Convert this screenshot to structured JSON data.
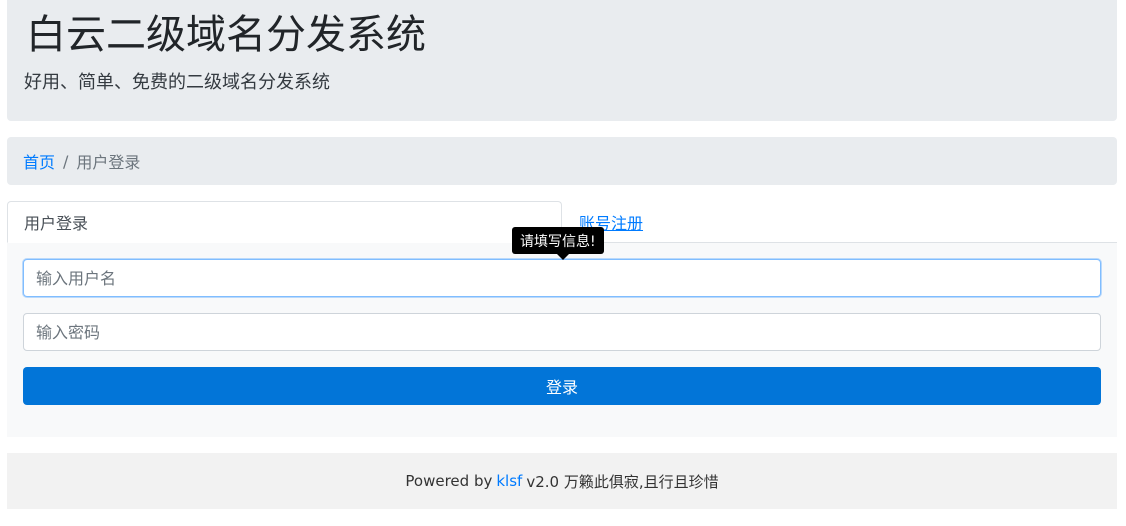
{
  "header": {
    "title": "白云二级域名分发系统",
    "subtitle": "好用、简单、免费的二级域名分发系统"
  },
  "breadcrumb": {
    "home": "首页",
    "separator": "/",
    "current": "用户登录"
  },
  "tabs": [
    {
      "label": "用户登录",
      "active": true
    },
    {
      "label": "账号注册",
      "active": false
    }
  ],
  "form": {
    "username_placeholder": "输入用户名",
    "username_value": "",
    "password_placeholder": "输入密码",
    "password_value": "",
    "submit_label": "登录"
  },
  "tooltip": {
    "text": "请填写信息!"
  },
  "footer": {
    "prefix": "Powered by",
    "link": "klsf",
    "suffix": "v2.0 万籁此俱寂,且行且珍惜"
  },
  "colors": {
    "accent": "#007bff",
    "button": "#0275d8",
    "jumbotron_bg": "#e9ecef",
    "panel_bg": "#f8f9fa"
  }
}
